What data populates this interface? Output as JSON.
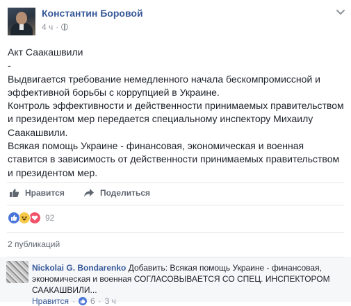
{
  "post": {
    "author": "Константин Боровой",
    "time": "4 ч",
    "privacy_icon": "globe-icon",
    "menu_icon": "chevron-down-icon",
    "paragraphs": [
      "Акт Саакашвили",
      "-",
      "Выдвигается требование немедленного начала бескомпромиссной и эффективной борьбы с коррупцией в Украине.",
      "Контроль эффективности и действенности принимаемых правительством и президентом мер передается специальному инспектору Михаилу Саакашвили.",
      "Всякая помощь Украине - финансовая, экономическая и военная ставится в зависимость от действенности принимаемых правительством и президентом мер."
    ]
  },
  "actions": {
    "like_label": "Нравится",
    "share_label": "Поделиться"
  },
  "reactions": {
    "types": [
      "like-icon",
      "haha-icon",
      "love-icon"
    ],
    "count": "92"
  },
  "shares": {
    "label": "2 публикаций"
  },
  "comment": {
    "author": "Nickolai G. Bondarenko",
    "text": "Добавить: Всякая помощь Украине - финансовая, экономическая и военная СОГЛАСОВЫВАЕТСЯ СО СПЕЦ. ИНСПЕКТОРОМ САAКАШВИЛИ...",
    "like_label": "Нравится",
    "separator": "·",
    "reaction_count": "6",
    "time": "3 ч"
  },
  "colors": {
    "link": "#365899",
    "secondary_text": "#90949c",
    "like_blue": "#4a76d9",
    "love_red": "#f25268",
    "haha_yellow": "#f7c94b"
  }
}
